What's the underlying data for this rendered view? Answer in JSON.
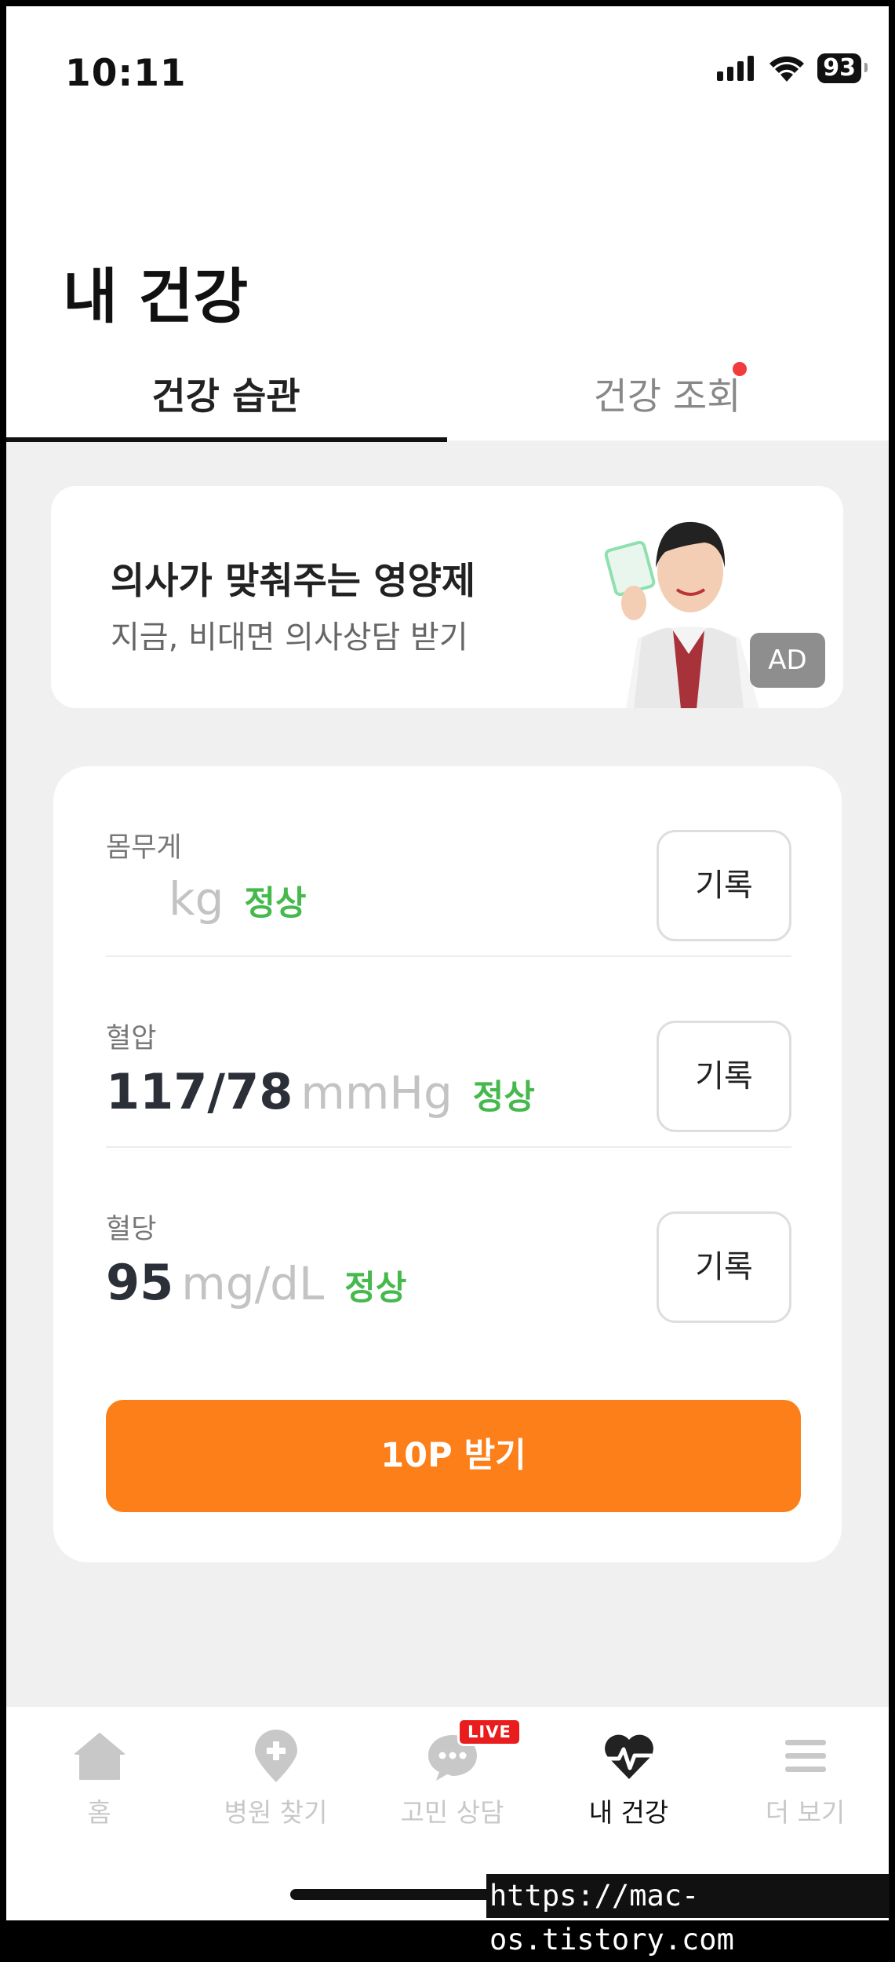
{
  "status_bar": {
    "time": "10:11",
    "battery": "93"
  },
  "page": {
    "title": "내 건강"
  },
  "tabs": [
    {
      "label": "건강 습관",
      "active": true
    },
    {
      "label": "건강 조회",
      "active": false,
      "has_new_dot": true
    }
  ],
  "ad": {
    "title": "의사가 맞춰주는 영양제",
    "subtitle": "지금, 비대면 의사상담 받기",
    "badge": "AD"
  },
  "metrics": [
    {
      "label": "몸무게",
      "value": "",
      "unit": "kg",
      "status": "정상",
      "button": "기록"
    },
    {
      "label": "혈압",
      "value": "117/78",
      "unit": "mmHg",
      "status": "정상",
      "button": "기록"
    },
    {
      "label": "혈당",
      "value": "95",
      "unit": "mg/dL",
      "status": "정상",
      "button": "기록"
    }
  ],
  "claim_button": "10P 받기",
  "nav": [
    {
      "label": "홈",
      "icon": "home-icon"
    },
    {
      "label": "병원 찾기",
      "icon": "hospital-pin-icon"
    },
    {
      "label": "고민 상담",
      "icon": "chat-bubble-icon",
      "badge": "LIVE"
    },
    {
      "label": "내 건강",
      "icon": "heart-pulse-icon",
      "active": true
    },
    {
      "label": "더 보기",
      "icon": "menu-icon"
    }
  ],
  "watermark": "https://mac-os.tistory.com",
  "colors": {
    "accent": "#fd7f1a",
    "status_normal": "#45b94c",
    "live_red": "#e91d1d"
  }
}
